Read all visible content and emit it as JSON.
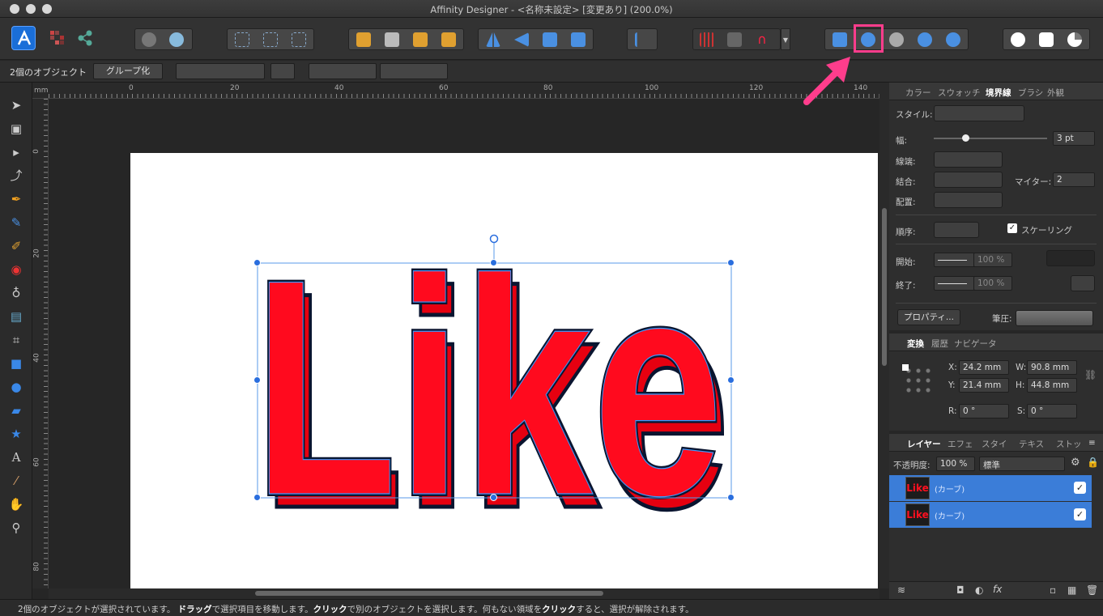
{
  "window": {
    "title": "Affinity Designer - <名称未設定> [変更あり] (200.0%)"
  },
  "context_bar": {
    "selection_label": "2個のオブジェクト",
    "group_button": "グループ化"
  },
  "ruler": {
    "unit": "mm",
    "h_ticks": [
      "0",
      "20",
      "40",
      "60",
      "80",
      "100",
      "120",
      "140"
    ],
    "v_ticks": [
      "0",
      "20",
      "40",
      "60",
      "80"
    ]
  },
  "canvas": {
    "text": "Like",
    "fill_color": "#ff0a1e",
    "outline_color": "#0a1530",
    "highlight_color": "#ff3d8c"
  },
  "stroke_panel": {
    "tabs": [
      "カラー",
      "スウォッチ",
      "境界線",
      "ブラシ",
      "外観"
    ],
    "style_label": "スタイル:",
    "width_label": "幅:",
    "width_value": "3 pt",
    "cap_label": "線端:",
    "join_label": "結合:",
    "miter_label": "マイター:",
    "miter_value": "2",
    "align_label": "配置:",
    "order_label": "順序:",
    "scaling_label": "スケーリング",
    "start_label": "開始:",
    "start_pct": "100 %",
    "end_label": "終了:",
    "end_pct": "100 %",
    "properties_button": "プロパティ...",
    "pressure_label": "筆圧:"
  },
  "transform_panel": {
    "tabs": [
      "変換",
      "履歴",
      "ナビゲータ"
    ],
    "x_label": "X:",
    "x_value": "24.2 mm",
    "w_label": "W:",
    "w_value": "90.8 mm",
    "y_label": "Y:",
    "y_value": "21.4 mm",
    "h_label": "H:",
    "h_value": "44.8 mm",
    "r_label": "R:",
    "r_value": "0 °",
    "s_label": "S:",
    "s_value": "0 °"
  },
  "layers_panel": {
    "tabs": [
      "レイヤー",
      "エフェ",
      "スタイ",
      "テキス",
      "ストッ"
    ],
    "opacity_label": "不透明度:",
    "opacity_value": "100 %",
    "blend_mode": "標準",
    "layers": [
      {
        "thumb": "Like",
        "name": "(カーブ)",
        "check": "✓"
      },
      {
        "thumb": "Like",
        "name": "(カーブ)",
        "check": "✓"
      }
    ]
  },
  "status": {
    "p1": "2個のオブジェクトが選択されています。",
    "b1": "ドラッグ",
    "p2": "で選択項目を移動します。",
    "b2": "クリック",
    "p3": "で別のオブジェクトを選択します。何もない領域を",
    "b3": "クリック",
    "p4": "すると、選択が解除されます。"
  },
  "tools": [
    "move-tool",
    "artboard-tool",
    "node-tool",
    "corner-tool",
    "pen-tool",
    "pencil-tool",
    "vector-brush-tool",
    "fill-tool",
    "transparency-tool",
    "place-image-tool",
    "crop-tool",
    "rectangle-tool",
    "ellipse-tool",
    "rounded-rect-tool",
    "star-tool",
    "text-tool",
    "color-picker-tool",
    "view-tool",
    "zoom-tool"
  ]
}
